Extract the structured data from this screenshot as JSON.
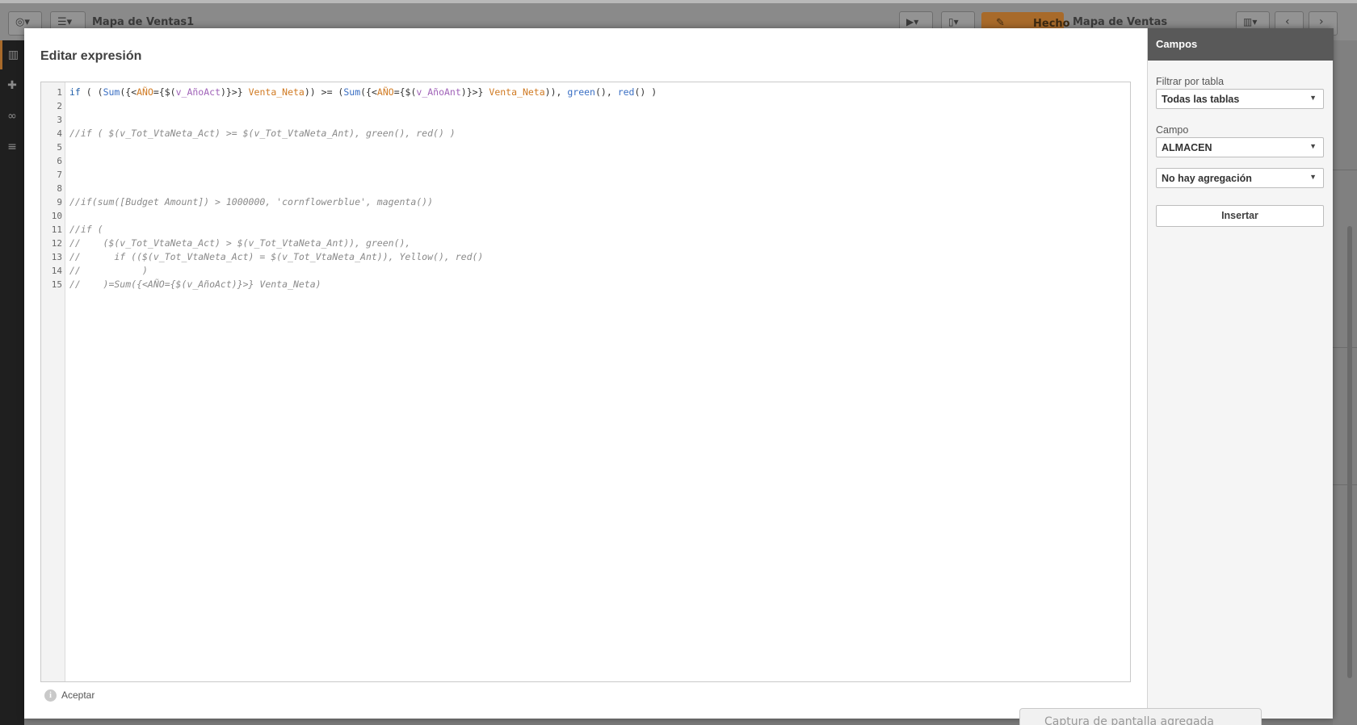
{
  "app_toolbar": {
    "sheet_title": "Mapa de Ventas1",
    "done_label": "Hecho",
    "sheet_name": "Mapa de Ventas"
  },
  "modal": {
    "title": "Editar expresión",
    "footer_status": "Aceptar"
  },
  "editor": {
    "line_numbers": [
      "1",
      "2",
      "3",
      "4",
      "5",
      "6",
      "7",
      "8",
      "9",
      "10",
      "11",
      "12",
      "13",
      "14",
      "15"
    ],
    "lines": [
      "if ( (Sum({<AÑO={$(v_AñoAct)}>} Venta_Neta)) >= (Sum({<AÑO={$(v_AñoAnt)}>} Venta_Neta)), green(), red() )",
      "",
      "",
      "//if ( $(v_Tot_VtaNeta_Act) >= $(v_Tot_VtaNeta_Ant), green(), red() )",
      "",
      "",
      "",
      "",
      "//if(sum([Budget Amount]) > 1000000, 'cornflowerblue', magenta())",
      "",
      "//if (",
      "//    ($(v_Tot_VtaNeta_Act) > $(v_Tot_VtaNeta_Ant)), green(),",
      "//      if (($(v_Tot_VtaNeta_Act) = $(v_Tot_VtaNeta_Ant)), Yellow(), red()",
      "//           )",
      "//    )=Sum({<AÑO={$(v_AñoAct)}>} Venta_Neta)"
    ],
    "line1_tokens": {
      "t0": "if",
      "t1": " ( (",
      "t2": "Sum",
      "t3": "({<",
      "t4": "AÑO",
      "t5": "={$(",
      "t6": "v_AñoAct",
      "t7": ")}>} ",
      "t8": "Venta_Neta",
      "t9": ")) >= (",
      "t10": "Sum",
      "t11": "({<",
      "t12": "AÑO",
      "t13": "={$(",
      "t14": "v_AñoAnt",
      "t15": ")}>} ",
      "t16": "Venta_Neta",
      "t17": ")), ",
      "t18": "green",
      "t19": "(), ",
      "t20": "red",
      "t21": "() )"
    }
  },
  "fields_panel": {
    "title": "Campos",
    "filter_label": "Filtrar por tabla",
    "filter_value": "Todas las tablas",
    "field_label": "Campo",
    "field_value": "ALMACEN",
    "aggregation_value": "No hay agregación",
    "insert_label": "Insertar"
  },
  "toast": {
    "text": "Captura de pantalla agregada"
  },
  "colors": {
    "accent": "#a86a2a",
    "panel_header": "#595959",
    "keyword": "#1f5ea8",
    "field": "#d07a22",
    "variable": "#a062b8",
    "comment": "#8a8a8a"
  }
}
